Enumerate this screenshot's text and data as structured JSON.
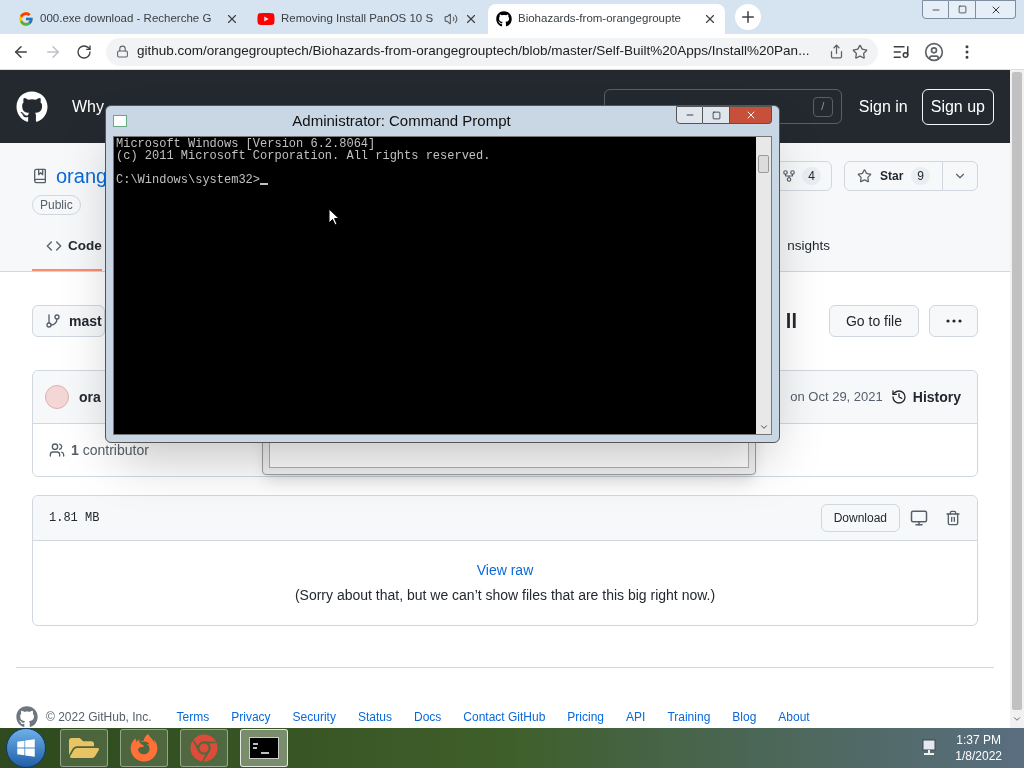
{
  "browser_tabs": [
    {
      "title": "000.exe download - Recherche G",
      "kind": "google",
      "selected": false,
      "audio": false
    },
    {
      "title": "Removing Install PanOS 10 S",
      "kind": "youtube",
      "selected": false,
      "audio": true
    },
    {
      "title": "Biohazards-from-orangegroupte",
      "kind": "github",
      "selected": true,
      "audio": false
    }
  ],
  "toolbar": {
    "url": "github.com/orangegrouptech/Biohazards-from-orangegrouptech/blob/master/Self-Built%20Apps/Install%20Pan...",
    "forward_disabled": true
  },
  "header": {
    "nav_visible": "Why",
    "search_key": "/",
    "sign_in": "Sign in",
    "sign_up": "Sign up"
  },
  "repo": {
    "name": "orang",
    "visibility": "Public",
    "fork_count": "4",
    "star_label": "Star",
    "star_count": "9"
  },
  "tabs": [
    {
      "label": "Code",
      "selected": true
    },
    {
      "label": "nsights",
      "selected": false
    }
  ],
  "file_nav": {
    "branch": "mast",
    "heading_fragment": "ll",
    "go_to_file": "Go to file"
  },
  "commit": {
    "author": "ora",
    "date": "on Oct 29, 2021",
    "history": "History",
    "contributors": "**1** contributor"
  },
  "file": {
    "size": "1.81 MB",
    "download": "Download",
    "view_raw": "View raw",
    "message": "(Sorry about that, but we can’t show files that are this big right now.)"
  },
  "footer": {
    "copyright": "© 2022 GitHub, Inc.",
    "links": [
      "Terms",
      "Privacy",
      "Security",
      "Status",
      "Docs",
      "Contact GitHub",
      "Pricing",
      "API",
      "Training",
      "Blog",
      "About"
    ]
  },
  "cmd": {
    "title": "Administrator: Command Prompt",
    "output": [
      "Microsoft Windows [Version 6.2.8064]",
      "(c) 2011 Microsoft Corporation. All rights reserved."
    ],
    "prompt": "C:\\Windows\\system32>"
  },
  "taskbar": {
    "apps": [
      {
        "kind": "explorer",
        "selected": false
      },
      {
        "kind": "firefox",
        "selected": false
      },
      {
        "kind": "chrome",
        "selected": false
      },
      {
        "kind": "cmd",
        "selected": true
      }
    ],
    "time": "1:37 PM",
    "date": "1/8/2022"
  }
}
